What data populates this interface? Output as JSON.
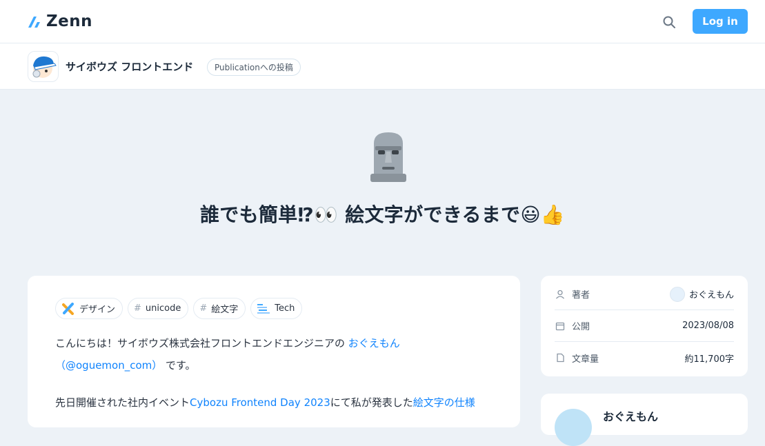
{
  "header": {
    "logo_text": "Zenn",
    "search_icon": "search-icon",
    "login_label": "Log in",
    "accent_color": "#3ea8ff"
  },
  "publication": {
    "name": "サイボウズ フロントエンド",
    "badge": "Publicationへの投稿"
  },
  "article": {
    "emoji": "moai",
    "title": "誰でも簡単⁉︎👀 絵文字ができるまで😃👍",
    "topics": [
      {
        "label": "デザイン",
        "icon": "design-icon"
      },
      {
        "label": "unicode",
        "icon": "hash"
      },
      {
        "label": "絵文字",
        "icon": "hash"
      },
      {
        "label": "Tech",
        "icon": "tech-icon"
      }
    ],
    "p1": {
      "text1": "こんにちは！サイボウズ株式会社フロントエンドエンジニアの ",
      "link1": "おぐえもん",
      "link2": "（@oguemon_com）",
      "text2": " です。"
    },
    "p2": {
      "text1": "先日開催された社内イベント",
      "link1": "Cybozu Frontend Day 2023",
      "text2": "にて私が発表した",
      "link2": "絵文字の仕様"
    }
  },
  "sidebar": {
    "rows": [
      {
        "label": "著者",
        "value": "おぐえもん",
        "icon": "user-icon"
      },
      {
        "label": "公開",
        "value": "2023/08/08",
        "icon": "calendar-icon"
      },
      {
        "label": "文章量",
        "value": "約11,700字",
        "icon": "document-icon"
      }
    ],
    "author_card_name": "おぐえもん"
  }
}
